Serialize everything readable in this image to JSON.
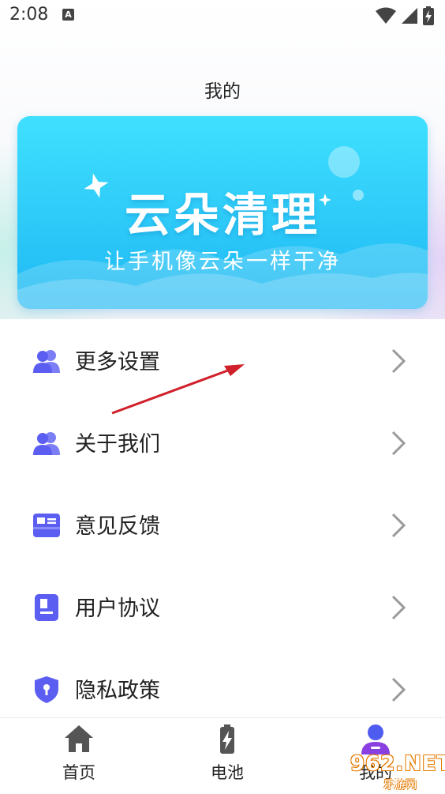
{
  "status_bar": {
    "time": "2:08",
    "notification_letter": "A"
  },
  "header": {
    "title": "我的"
  },
  "banner": {
    "title": "云朵清理",
    "subtitle": "让手机像云朵一样干净"
  },
  "menu": [
    {
      "label": "更多设置",
      "icon": "users-icon"
    },
    {
      "label": "关于我们",
      "icon": "users-icon"
    },
    {
      "label": "意见反馈",
      "icon": "feedback-icon"
    },
    {
      "label": "用户协议",
      "icon": "document-icon"
    },
    {
      "label": "隐私政策",
      "icon": "shield-lock-icon"
    }
  ],
  "tabs": [
    {
      "label": "首页",
      "icon": "home-icon"
    },
    {
      "label": "电池",
      "icon": "battery-icon"
    },
    {
      "label": "我的",
      "icon": "profile-icon",
      "active": true
    }
  ],
  "watermark": {
    "text": "962.NET",
    "sub": "乐游网"
  },
  "colors": {
    "banner_top": "#3fe0ff",
    "banner_bottom": "#1fb8f3",
    "icon_purple": "#5b5ef0",
    "annotation_arrow": "#d0202a",
    "chevron": "#9a9a9a"
  }
}
